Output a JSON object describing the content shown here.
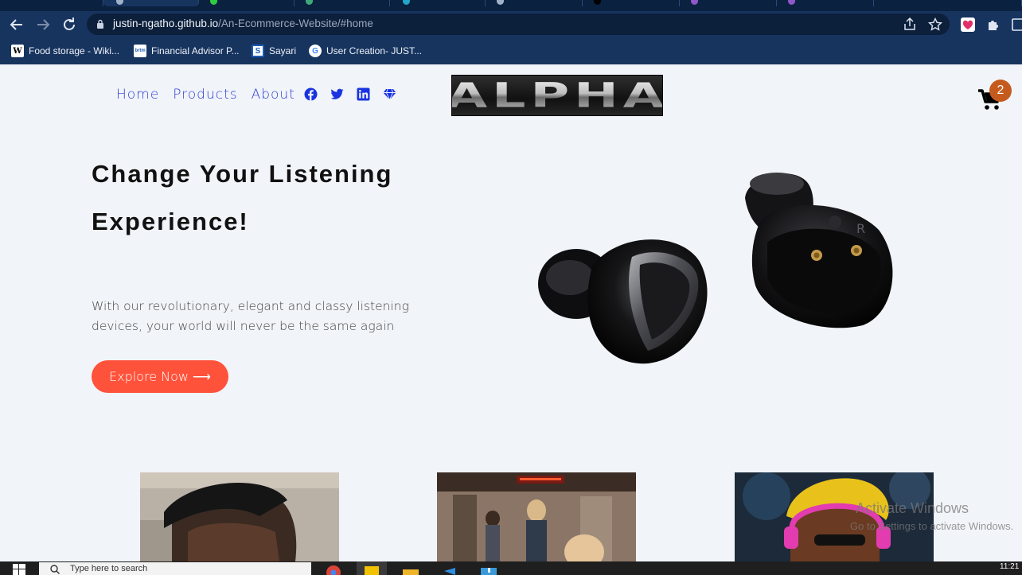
{
  "browser": {
    "url_host": "justin-ngatho.github.io",
    "url_path": "/An-Ecommerce-Website/#home",
    "back_icon": "back-arrow-icon",
    "forward_icon": "forward-arrow-icon",
    "reload_icon": "reload-icon",
    "bookmarks": [
      {
        "label": "Food storage - Wiki...",
        "icon": "wikipedia-icon"
      },
      {
        "label": "Financial Advisor P...",
        "icon": "britam-icon"
      },
      {
        "label": "Sayari",
        "icon": "sayari-icon"
      },
      {
        "label": "User Creation- JUST...",
        "icon": "google-icon"
      }
    ]
  },
  "site": {
    "nav": [
      "Home",
      "Products",
      "About"
    ],
    "social_icons": [
      "facebook-icon",
      "twitter-icon",
      "linkedin-icon",
      "diamond-icon"
    ],
    "logo_text": "ALPHA",
    "cart_count": "2",
    "hero_title_line1": "Change Your Listening",
    "hero_title_line2": "Experience!",
    "hero_subtitle": "With our revolutionary, elegant and classy listening devices, your world will never be the same again",
    "cta_label": "Explore Now ⟶"
  },
  "overlay": {
    "watermark_title": "Activate Windows",
    "watermark_subtitle": "Go to Settings to activate Windows."
  },
  "taskbar": {
    "search_placeholder": "Type here to search",
    "clock": "11:21"
  },
  "colors": {
    "accent_nav": "#2f3fd6",
    "cta": "#ff523b",
    "cart_badge": "#c55a1e",
    "chrome": "#17345f"
  }
}
